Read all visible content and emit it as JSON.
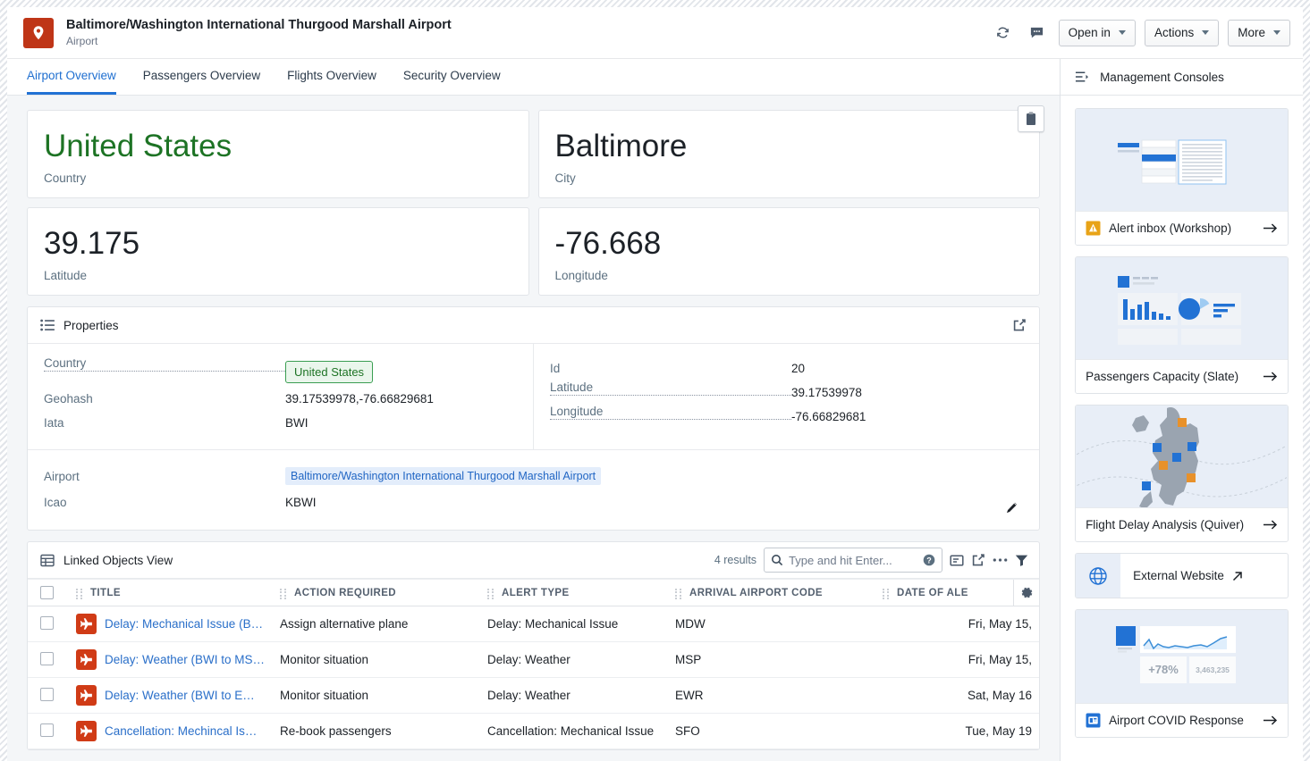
{
  "header": {
    "object_icon": "map-pin-icon",
    "title": "Baltimore/Washington International Thurgood Marshall Airport",
    "subtitle": "Airport",
    "refresh_icon": "refresh-icon",
    "comment_icon": "comment-icon",
    "buttons": [
      {
        "label": "Open in",
        "name": "open-in-button"
      },
      {
        "label": "Actions",
        "name": "actions-button"
      },
      {
        "label": "More",
        "name": "more-button"
      }
    ]
  },
  "tabs": [
    {
      "label": "Airport Overview",
      "active": true
    },
    {
      "label": "Passengers Overview",
      "active": false
    },
    {
      "label": "Flights Overview",
      "active": false
    },
    {
      "label": "Security Overview",
      "active": false
    }
  ],
  "metrics": [
    {
      "value": "United States",
      "label": "Country",
      "accent": "#1d7324"
    },
    {
      "value": "Baltimore",
      "label": "City",
      "accent": "#1c2127"
    },
    {
      "value": "39.175",
      "label": "Latitude",
      "accent": "#1c2127"
    },
    {
      "value": "-76.668",
      "label": "Longitude",
      "accent": "#1c2127"
    }
  ],
  "properties": {
    "title": "Properties",
    "icon": "list-icon",
    "expand_icon": "open-in-new-icon",
    "left_rows": [
      {
        "key": "Country",
        "value": "United States",
        "type": "tag-green",
        "linked": true
      },
      {
        "key": "Geohash",
        "value": "39.17539978,-76.66829681",
        "type": "text",
        "linked": false
      },
      {
        "key": "Iata",
        "value": "BWI",
        "type": "text",
        "linked": false
      }
    ],
    "right_rows": [
      {
        "key": "Id",
        "value": "20",
        "type": "text",
        "linked": false
      },
      {
        "key": "Latitude",
        "value": "39.17539978",
        "type": "text",
        "linked": true
      },
      {
        "key": "Longitude",
        "value": "-76.66829681",
        "type": "text",
        "linked": true
      }
    ],
    "footer_rows": [
      {
        "key": "Airport",
        "value": "Baltimore/Washington International Thurgood Marshall Airport",
        "type": "tag-blue"
      },
      {
        "key": "Icao",
        "value": "KBWI",
        "type": "text"
      }
    ],
    "edit_icon": "pencil-icon"
  },
  "linked_objects": {
    "title": "Linked Objects View",
    "icon": "table-icon",
    "results_text": "4 results",
    "search_placeholder": "Type and hit Enter...",
    "search_value": "",
    "search_icon": "search-icon",
    "help_icon": "help-circle-icon",
    "toolbar_icons": [
      "comment-box-icon",
      "open-in-new-icon",
      "more-horizontal-icon",
      "filter-icon"
    ],
    "gear_icon": "gear-icon",
    "columns": [
      "TITLE",
      "ACTION REQUIRED",
      "ALERT TYPE",
      "ARRIVAL AIRPORT CODE",
      "DATE OF ALE"
    ],
    "rows": [
      {
        "icon": "airplane-icon",
        "title": "Delay: Mechanical Issue (B…",
        "action_required": "Assign alternative plane",
        "alert_type": "Delay: Mechanical Issue",
        "arrival_airport_code": "MDW",
        "date_of_alert": "Fri, May 15,"
      },
      {
        "icon": "airplane-icon",
        "title": "Delay: Weather (BWI to MS…",
        "action_required": "Monitor situation",
        "alert_type": "Delay: Weather",
        "arrival_airport_code": "MSP",
        "date_of_alert": "Fri, May 15,"
      },
      {
        "icon": "airplane-icon",
        "title": "Delay: Weather (BWI to E…",
        "action_required": "Monitor situation",
        "alert_type": "Delay: Weather",
        "arrival_airport_code": "EWR",
        "date_of_alert": "Sat, May 16"
      },
      {
        "icon": "airplane-icon",
        "title": "Cancellation: Mechincal Is…",
        "action_required": "Re-book passengers",
        "alert_type": "Cancellation: Mechanical Issue",
        "arrival_airport_code": "SFO",
        "date_of_alert": "Tue, May 19"
      }
    ]
  },
  "sidebar": {
    "title": "Management Consoles",
    "panel_icon": "collapse-panel-icon",
    "consoles": [
      {
        "label": "Alert inbox (Workshop)",
        "thumb": "workshop-inbox-thumb",
        "badge_icon": "warning-icon",
        "arrow_icon": "arrow-right-icon"
      },
      {
        "label": "Passengers Capacity (Slate)",
        "thumb": "slate-dashboard-thumb",
        "badge_icon": null,
        "arrow_icon": "arrow-right-icon"
      },
      {
        "label": "Flight Delay Analysis (Quiver)",
        "thumb": "quiver-map-thumb",
        "badge_icon": null,
        "arrow_icon": "arrow-right-icon"
      }
    ],
    "external": {
      "label": "External Website",
      "icon": "globe-icon",
      "link_icon": "external-link-icon"
    },
    "covid": {
      "label": "Airport COVID Response",
      "thumb": "covid-chart-thumb",
      "badge_icon": "blue-card-icon",
      "arrow_icon": "arrow-right-icon",
      "stat_percent": "+78%",
      "stat_count": "3,463,235"
    }
  }
}
